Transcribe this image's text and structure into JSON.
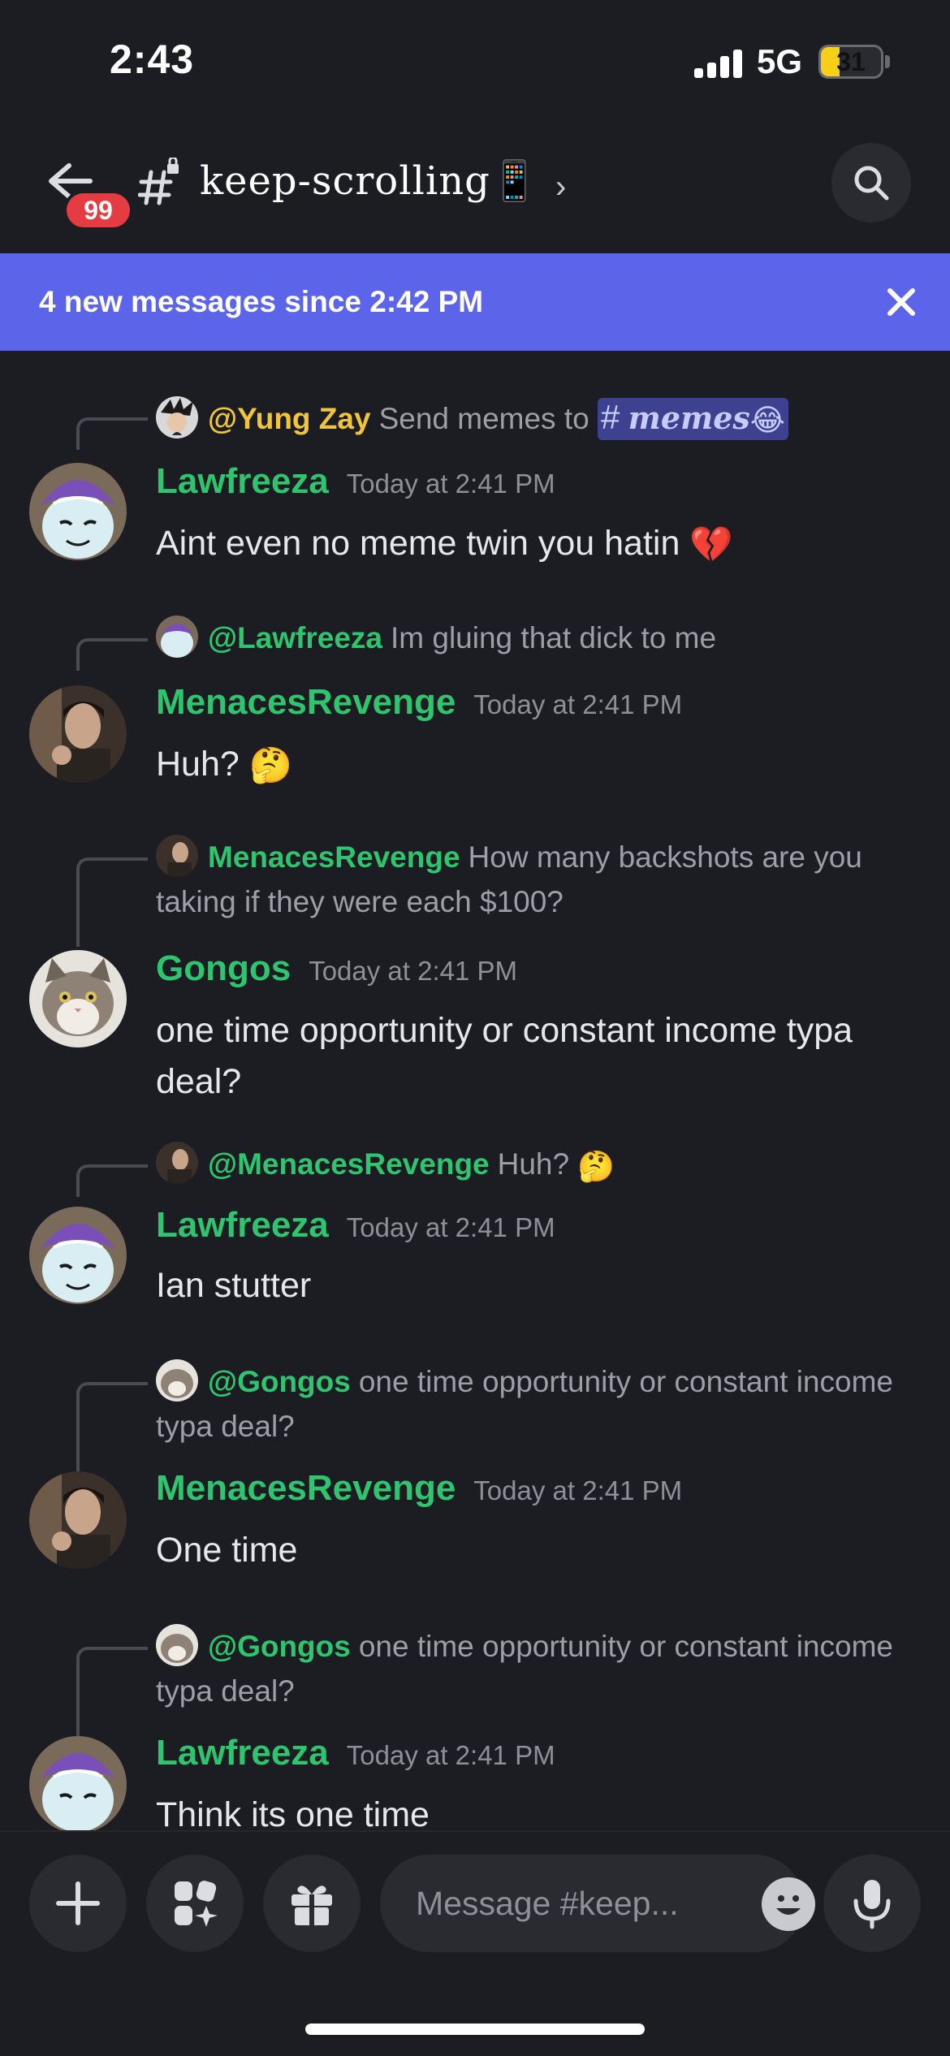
{
  "status_bar": {
    "time": "2:43",
    "network": "5G",
    "battery": "31",
    "battery_level": 0.31
  },
  "header": {
    "unread_count": "99",
    "channel_name": "keep-scrolling📱",
    "chevron": "›",
    "back_icon": "arrow-left-icon",
    "search_icon": "search-icon"
  },
  "banner": {
    "text": "4 new messages since 2:42 PM",
    "close_icon": "close-icon"
  },
  "messages": [
    {
      "reply": {
        "author": "@Yung Zay",
        "author_color": "#f0c43b",
        "text_prefix": "Send memes to ",
        "chip_hash": "#",
        "chip_text": "memes",
        "chip_emoji": "😂"
      },
      "author": "Lawfreeza",
      "timestamp": "Today at 2:41 PM",
      "text": "Aint even no meme twin you hatin",
      "text_emoji": "💔"
    },
    {
      "reply": {
        "author": "@Lawfreeza",
        "author_color": "#2fc46e",
        "text": "Im gluing that dick to me"
      },
      "author": "MenacesRevenge",
      "timestamp": "Today at 2:41 PM",
      "text": "Huh?",
      "text_emoji": "🤔"
    },
    {
      "reply": {
        "author": "MenacesRevenge",
        "author_color": "#2fc46e",
        "text": "How many backshots are you taking if they were each $100?"
      },
      "author": "Gongos",
      "timestamp": "Today at 2:41 PM",
      "text": "one time opportunity or constant income typa deal?"
    },
    {
      "reply": {
        "author": "@MenacesRevenge",
        "author_color": "#2fc46e",
        "text": "Huh?",
        "text_emoji": "🤔"
      },
      "author": "Lawfreeza",
      "timestamp": "Today at 2:41 PM",
      "text": "Ian stutter"
    },
    {
      "reply": {
        "author": "@Gongos",
        "author_color": "#2fc46e",
        "text": "one time opportunity or constant income typa deal?"
      },
      "author": "MenacesRevenge",
      "timestamp": "Today at 2:41 PM",
      "text": "One time"
    },
    {
      "reply": {
        "author": "@Gongos",
        "author_color": "#2fc46e",
        "text": "one time opportunity or constant income typa deal?"
      },
      "author": "Lawfreeza",
      "timestamp": "Today at 2:41 PM",
      "text": "Think its one time"
    }
  ],
  "composer": {
    "placeholder": "Message #keep...",
    "buttons": [
      "plus-icon",
      "apps-icon",
      "gift-icon",
      "emoji-icon",
      "microphone-icon"
    ]
  }
}
